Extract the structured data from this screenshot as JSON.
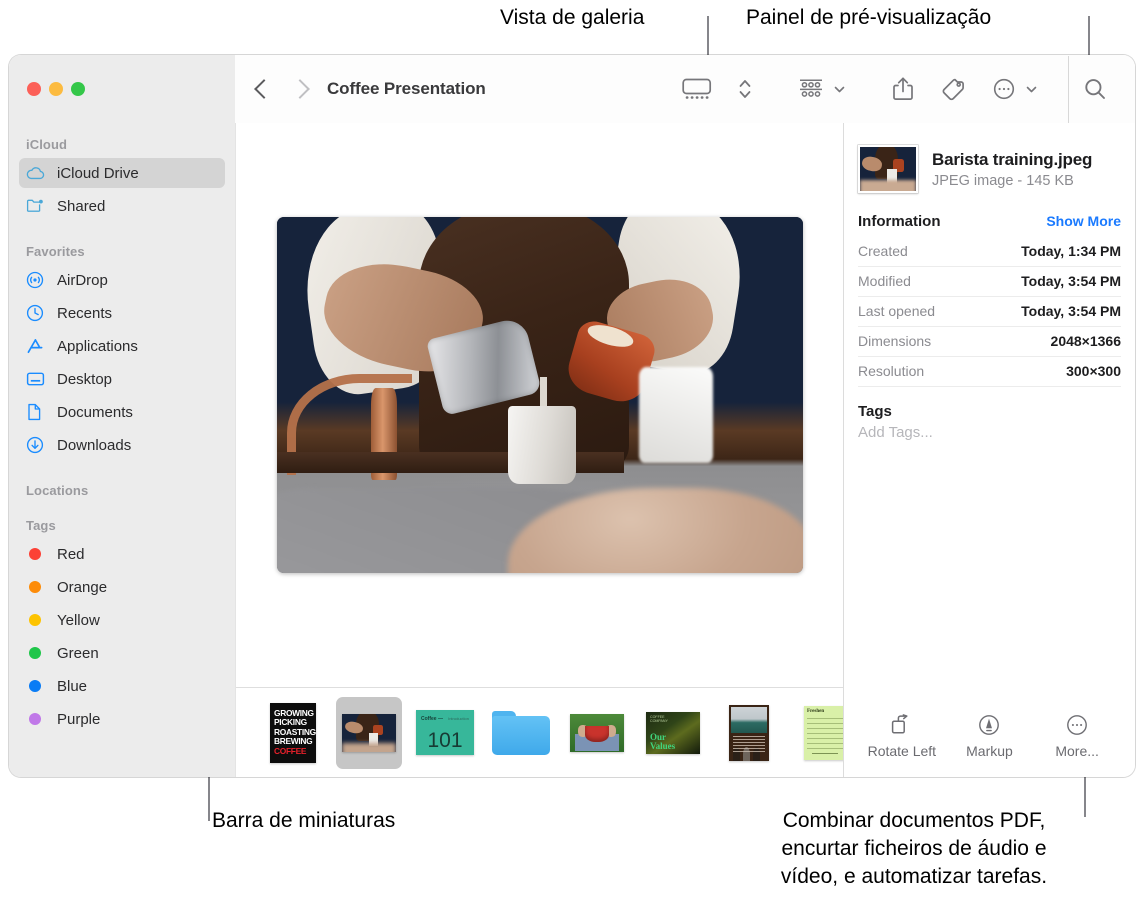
{
  "callouts": [
    {
      "id": "gallery-view",
      "text": "Vista de galeria"
    },
    {
      "id": "preview-panel",
      "text": "Painel de pré-visualização"
    },
    {
      "id": "thumbnail-bar",
      "text": "Barra de miniaturas"
    },
    {
      "id": "more-actions",
      "text": "Combinar documentos PDF,\nencurtar ficheiros de áudio e\nvídeo, e automatizar tarefas."
    }
  ],
  "window": {
    "title": "Coffee Presentation",
    "traffic_lights": [
      {
        "name": "close",
        "color": "#fc6058"
      },
      {
        "name": "minimize",
        "color": "#fcbb40"
      },
      {
        "name": "zoom",
        "color": "#34c749"
      }
    ],
    "toolbar": {
      "back_label": "Back",
      "forward_label": "Forward",
      "gallery_view_label": "Gallery View",
      "view_stepper_label": "Change view",
      "group_label": "Group items",
      "share_label": "Share",
      "tags_label": "Edit Tags",
      "action_label": "Action",
      "search_label": "Search"
    }
  },
  "sidebar": {
    "sections": [
      {
        "header": "iCloud",
        "items": [
          {
            "label": "iCloud Drive",
            "icon": "cloud-icon",
            "selected": true
          },
          {
            "label": "Shared",
            "icon": "shared-folder-icon",
            "selected": false
          }
        ]
      },
      {
        "header": "Favorites",
        "items": [
          {
            "label": "AirDrop",
            "icon": "airdrop-icon",
            "selected": false
          },
          {
            "label": "Recents",
            "icon": "clock-icon",
            "selected": false
          },
          {
            "label": "Applications",
            "icon": "applications-icon",
            "selected": false
          },
          {
            "label": "Desktop",
            "icon": "desktop-icon",
            "selected": false
          },
          {
            "label": "Documents",
            "icon": "document-icon",
            "selected": false
          },
          {
            "label": "Downloads",
            "icon": "downloads-icon",
            "selected": false
          }
        ]
      },
      {
        "header": "Locations",
        "items": []
      },
      {
        "header": "Tags",
        "items": [
          {
            "label": "Red",
            "icon": "tag-dot",
            "color": "#fc4136"
          },
          {
            "label": "Orange",
            "icon": "tag-dot",
            "color": "#fd8c09"
          },
          {
            "label": "Yellow",
            "icon": "tag-dot",
            "color": "#fdc300"
          },
          {
            "label": "Green",
            "icon": "tag-dot",
            "color": "#1fc64a"
          },
          {
            "label": "Blue",
            "icon": "tag-dot",
            "color": "#0a7cf5"
          },
          {
            "label": "Purple",
            "icon": "tag-dot",
            "color": "#c078e8"
          }
        ]
      }
    ]
  },
  "gallery": {
    "hero_alt": "Barista pouring milk and coffee into a cup",
    "thumbnails": [
      {
        "name": "coffee-poster-thumb",
        "kind": "poster",
        "selected": false,
        "lines": [
          "GROWING",
          "PICKING",
          "ROASTING",
          "BREWING",
          "COFFEE"
        ]
      },
      {
        "name": "barista-training-thumb",
        "kind": "photo",
        "selected": true
      },
      {
        "name": "coffee-101-thumb",
        "kind": "slide",
        "selected": false,
        "number": "101",
        "header_left": "Coffee —",
        "header_right": "Introduction"
      },
      {
        "name": "folder-thumb",
        "kind": "folder",
        "selected": false
      },
      {
        "name": "berries-thumb",
        "kind": "photo",
        "selected": false
      },
      {
        "name": "our-values-thumb",
        "kind": "cover",
        "selected": false,
        "title": "Our\nValues"
      },
      {
        "name": "meeting-doc-thumb",
        "kind": "document",
        "selected": false
      },
      {
        "name": "invoice-thumb",
        "kind": "document",
        "selected": false,
        "title": "Freshen"
      }
    ]
  },
  "info_panel": {
    "file": {
      "name": "Barista training.jpeg",
      "subtitle": "JPEG image - 145 KB"
    },
    "information": {
      "title": "Information",
      "show_more": "Show More",
      "rows": [
        {
          "key": "Created",
          "value": "Today, 1:34 PM"
        },
        {
          "key": "Modified",
          "value": "Today, 3:54 PM"
        },
        {
          "key": "Last opened",
          "value": "Today, 3:54 PM"
        },
        {
          "key": "Dimensions",
          "value": "2048×1366"
        },
        {
          "key": "Resolution",
          "value": "300×300"
        }
      ]
    },
    "tags": {
      "title": "Tags",
      "placeholder": "Add Tags..."
    },
    "actions": [
      {
        "label": "Rotate Left",
        "icon": "rotate-left-icon"
      },
      {
        "label": "Markup",
        "icon": "markup-icon"
      },
      {
        "label": "More...",
        "icon": "ellipsis-circle-icon"
      }
    ]
  },
  "colors": {
    "accent": "#1a7aff",
    "sidebar_bg": "#ececec",
    "selection": "#d4d4d4"
  }
}
